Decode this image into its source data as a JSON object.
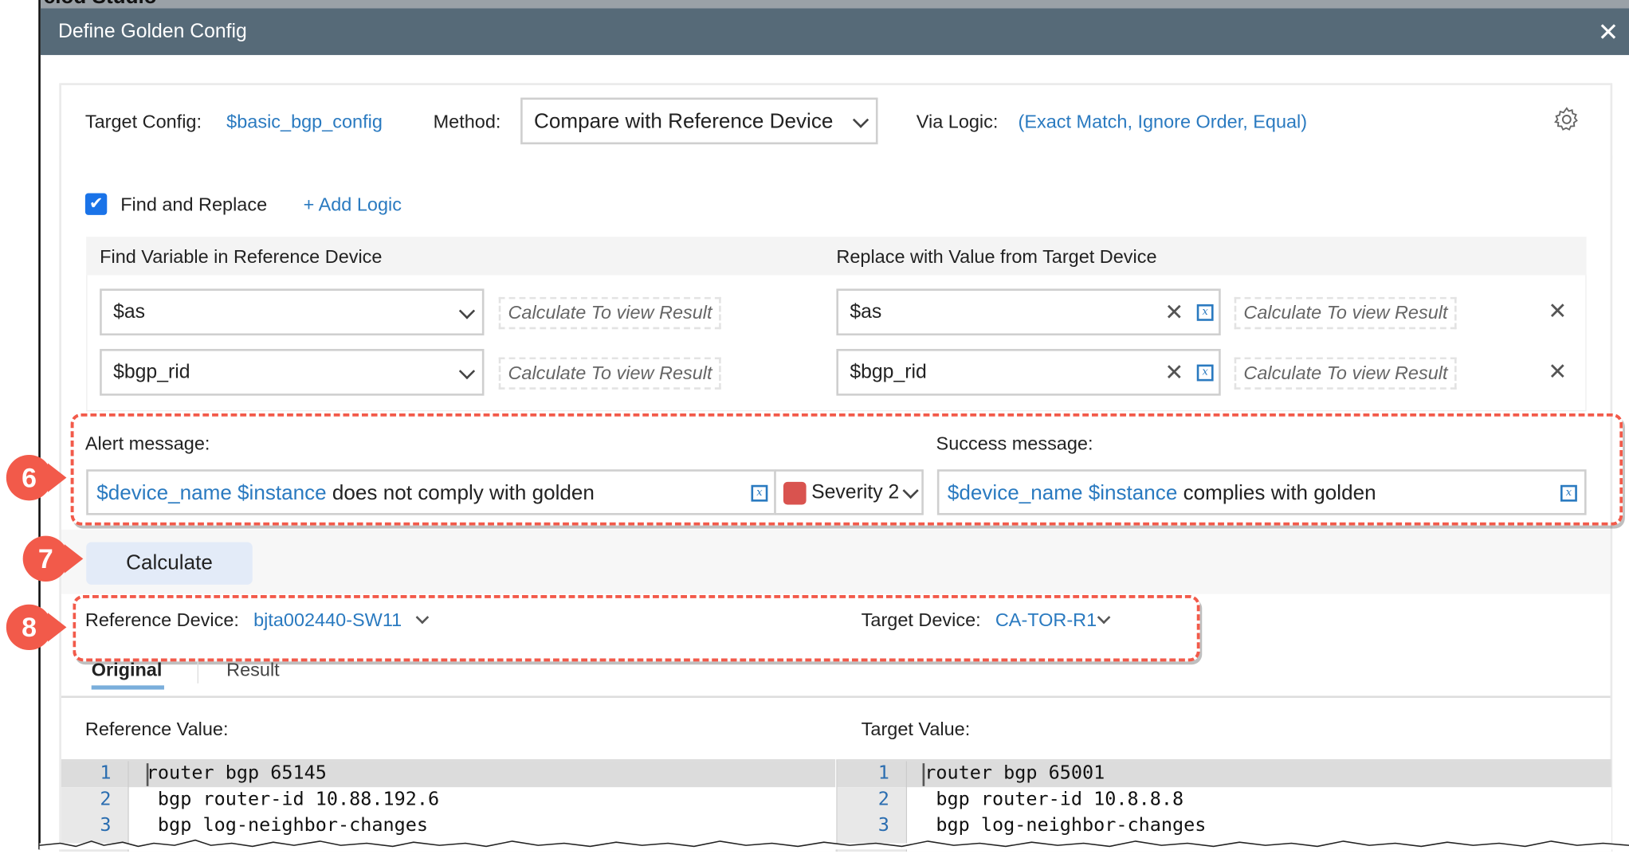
{
  "background_app_title": "ciod Studio",
  "dialog": {
    "title": "Define Golden Config",
    "close_icon": "close-icon"
  },
  "config": {
    "target_config_label": "Target Config:",
    "target_config_value": "$basic_bgp_config",
    "method_label": "Method:",
    "method_value": "Compare with Reference Device",
    "via_logic_label": "Via Logic:",
    "via_logic_value": "(Exact Match, Ignore Order, Equal)"
  },
  "find_replace": {
    "checked": true,
    "label": "Find and Replace",
    "add_logic": "+ Add Logic",
    "find_header": "Find Variable in Reference Device",
    "replace_header": "Replace with Value from Target Device",
    "rows": [
      {
        "find": "$as",
        "find_result": "Calculate To view Result",
        "replace": "$as",
        "replace_result": "Calculate To view Result"
      },
      {
        "find": "$bgp_rid",
        "find_result": "Calculate To view Result",
        "replace": "$bgp_rid",
        "replace_result": "Calculate To view Result"
      }
    ]
  },
  "messages": {
    "alert_label": "Alert message:",
    "alert_vars": "$device_name $instance",
    "alert_text": "does not comply with golden",
    "severity": "Severity 2",
    "severity_color": "#d9534f",
    "success_label": "Success message:",
    "success_vars": "$device_name $instance",
    "success_text": "complies with golden"
  },
  "calculate_button": "Calculate",
  "callouts": [
    "6",
    "7",
    "8"
  ],
  "devices": {
    "reference_label": "Reference Device:",
    "reference_value": "bjta002440-SW11",
    "target_label": "Target Device:",
    "target_value": "CA-TOR-R1"
  },
  "tabs": [
    {
      "label": "Original",
      "active": true
    },
    {
      "label": "Result",
      "active": false
    }
  ],
  "compare": {
    "reference_label": "Reference Value:",
    "target_label": "Target Value:",
    "reference_lines": [
      {
        "n": "1",
        "text": "router bgp 65145"
      },
      {
        "n": "2",
        "text": " bgp router-id 10.88.192.6"
      },
      {
        "n": "3",
        "text": " bgp log-neighbor-changes"
      }
    ],
    "target_lines": [
      {
        "n": "1",
        "text": "router bgp 65001"
      },
      {
        "n": "2",
        "text": " bgp router-id 10.8.8.8"
      },
      {
        "n": "3",
        "text": " bgp log-neighbor-changes"
      }
    ]
  }
}
